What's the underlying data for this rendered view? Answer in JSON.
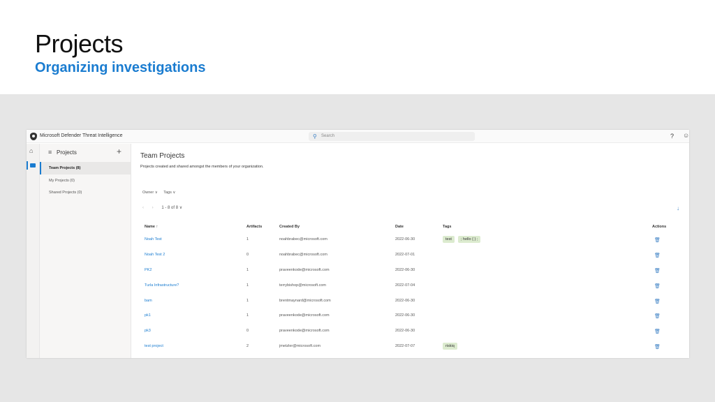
{
  "slide": {
    "title": "Projects",
    "subtitle": "Organizing investigations"
  },
  "app": {
    "title": "Microsoft Defender Threat Intelligence",
    "search_placeholder": "Search",
    "help_icon": "?",
    "user_icon": "♂"
  },
  "rail": {
    "home_icon": "⌂"
  },
  "nav": {
    "menu_icon": "≡",
    "title": "Projects",
    "add_icon": "+",
    "items": [
      {
        "label": "Team Projects (8)",
        "active": true
      },
      {
        "label": "My Projects (0)",
        "active": false
      },
      {
        "label": "Shared Projects (0)",
        "active": false
      }
    ]
  },
  "main": {
    "title": "Team Projects",
    "description": "Projects created and shared amongst the members of your organization.",
    "filters": [
      "Owner ∨",
      "Tags ∨"
    ],
    "pager": {
      "prev": "‹",
      "next": "›",
      "range": "1 - 8 of 8 ∨"
    },
    "download_icon": "↓",
    "columns": {
      "name": "Name ↑",
      "artifacts": "Artifacts",
      "created_by": "Created By",
      "date": "Date",
      "tags": "Tags",
      "actions": "Actions"
    },
    "trash_icon": "🗑",
    "rows": [
      {
        "name": "Noah Test",
        "artifacts": "1",
        "created_by": "noahbrabec@microsoft.com",
        "date": "2022-06-30",
        "tags": [
          "test",
          "; hello { } ;"
        ]
      },
      {
        "name": "Noah Test 2",
        "artifacts": "0",
        "created_by": "noahbrabec@microsoft.com",
        "date": "2022-07-01",
        "tags": []
      },
      {
        "name": "PK2",
        "artifacts": "1",
        "created_by": "praveenkode@microsoft.com",
        "date": "2022-06-30",
        "tags": []
      },
      {
        "name": "Turla Infrastructure?",
        "artifacts": "1",
        "created_by": "terrybishop@microsoft.com",
        "date": "2022-07-04",
        "tags": []
      },
      {
        "name": "bam",
        "artifacts": "1",
        "created_by": "brentmaynard@microsoft.com",
        "date": "2022-06-30",
        "tags": []
      },
      {
        "name": "pk1",
        "artifacts": "1",
        "created_by": "praveenkode@microsoft.com",
        "date": "2022-06-30",
        "tags": []
      },
      {
        "name": "pk3",
        "artifacts": "0",
        "created_by": "praveenkode@microsoft.com",
        "date": "2022-06-30",
        "tags": []
      },
      {
        "name": "test project",
        "artifacts": "2",
        "created_by": "jmetzler@microsoft.com",
        "date": "2022-07-07",
        "tags": [
          "riskiq"
        ]
      }
    ]
  }
}
